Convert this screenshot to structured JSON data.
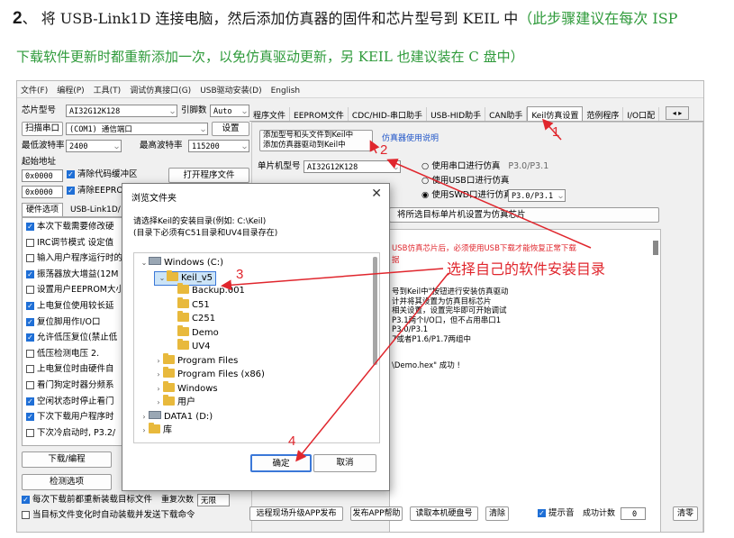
{
  "heading": {
    "number": "2",
    "sep": "、",
    "main": "将 USB-Link1D 连接电脑，然后添加仿真器的固件和芯片型号到 KEIL 中",
    "note_line1": "（此步骤建议在每次 ISP",
    "note_line2": "下载软件更新时都重新添加一次，以免仿真驱动更新，另 KEIL 也建议装在 C 盘中）"
  },
  "menu": [
    "文件(F)",
    "编程(P)",
    "工具(T)",
    "调试仿真接口(G)",
    "USB驱动安装(D)",
    "English"
  ],
  "left_panel": {
    "chip_label": "芯片型号",
    "chip_value": "AI32G12K128",
    "pin_label": "引脚数",
    "pin_value": "Auto",
    "scan_button": "扫描串口",
    "port_value": "(COM1) 通信端口",
    "settings_button": "设置",
    "min_baud_label": "最低波特率",
    "min_baud_value": "2400",
    "max_baud_label": "最高波特率",
    "max_baud_value": "115200",
    "start_addr_label": "起始地址",
    "addr1": "0x0000",
    "clear_code_label": "清除代码缓冲区",
    "open_file_button": "打开程序文件",
    "addr2": "0x0000",
    "clear_eeprom_label": "清除EEPROM缓",
    "hw_tab": "硬件选项",
    "link_tab": "USB-Link1D/",
    "options": [
      {
        "checked": true,
        "text": "本次下载需要修改硬"
      },
      {
        "checked": false,
        "text": "IRC调节模式   设定值"
      },
      {
        "checked": false,
        "text": "输入用户程序运行时的"
      },
      {
        "checked": true,
        "text": "振荡器放大增益(12M"
      },
      {
        "checked": false,
        "text": "设置用户EEPROM大小"
      },
      {
        "checked": true,
        "text": "上电复位使用较长延"
      },
      {
        "checked": true,
        "text": "复位脚用作I/O口"
      },
      {
        "checked": true,
        "text": "允许低压复位(禁止低"
      },
      {
        "checked": false,
        "text": "低压检测电压   2."
      },
      {
        "checked": false,
        "text": "上电复位时由硬件自"
      },
      {
        "checked": false,
        "text": "看门狗定时器分频系"
      },
      {
        "checked": true,
        "text": "空闲状态时停止看门"
      },
      {
        "checked": true,
        "text": "下次下载用户程序时"
      },
      {
        "checked": false,
        "text": "下次冷启动时, P3.2/"
      }
    ],
    "download_button": "下载/编程",
    "check_button": "检测选项",
    "bottom_check1": "每次下载前都重新装载目标文件",
    "repeat_label": "重复次数",
    "repeat_value": "无限",
    "bottom_check2": "当目标文件变化时自动装载并发送下载命令"
  },
  "right_panel": {
    "tabs": [
      "程序文件",
      "EEPROM文件",
      "CDC/HID-串口助手",
      "USB-HID助手",
      "CAN助手",
      "Keil仿真设置",
      "范例程序",
      "I/O口配"
    ],
    "add_button": "添加型号和头文件到Keil中\n添加仿真器驱动到Keil中",
    "sim_link": "仿真器使用说明",
    "mcu_label": "单片机型号",
    "mcu_value": "AI32G12K128",
    "radio1": "使用串口进行仿真",
    "radio1_value": "P3.0/P3.1",
    "radio2": "使用USB口进行仿真",
    "radio3": "使用SWD口进行仿真",
    "radio3_value": "P3.0/P3.1",
    "target_note": "将所选目标单片机设置为仿真芯片",
    "red_line1": "USB仿真芯片后，必须使用USB下载才能恢复正常下载",
    "red_line2": "据",
    "info_lines": [
      "号到Keil中\"按钮进行安装仿真驱动",
      "计并将其设置为仿真目标芯片",
      "相关设置，设置完毕即可开始调试",
      "P3.1两个I/O口，但不占用串口1",
      "P3.0/P3.1",
      "7或者P1.6/P1.7两组中"
    ],
    "log_line": "\\Demo.hex\" 成功 !",
    "bottom_buttons": [
      "远程现场升级APP发布",
      "发布APP帮助",
      "读取本机硬盘号",
      "清除"
    ],
    "prompt_label": "提示音",
    "count_label": "成功计数",
    "count_value": "0",
    "clear_button": "清零"
  },
  "dialog": {
    "title": "浏览文件夹",
    "desc1": "请选择Keil的安装目录(例如: C:\\Keil)",
    "desc2": "(目录下必须有C51目录和UV4目录存在)",
    "tree": [
      {
        "label": "Windows (C:)",
        "type": "drive",
        "level": 0,
        "expanded": true
      },
      {
        "label": "Keil_v5",
        "type": "folder",
        "level": 1,
        "expanded": true,
        "selected": true
      },
      {
        "label": "Backup.001",
        "type": "folder",
        "level": 2
      },
      {
        "label": "C51",
        "type": "folder",
        "level": 2
      },
      {
        "label": "C251",
        "type": "folder",
        "level": 2
      },
      {
        "label": "Demo",
        "type": "folder",
        "level": 2
      },
      {
        "label": "UV4",
        "type": "folder",
        "level": 2
      },
      {
        "label": "Program Files",
        "type": "folder",
        "level": 1
      },
      {
        "label": "Program Files (x86)",
        "type": "folder",
        "level": 1
      },
      {
        "label": "Windows",
        "type": "folder",
        "level": 1
      },
      {
        "label": "用户",
        "type": "folder",
        "level": 1
      },
      {
        "label": "DATA1 (D:)",
        "type": "drive",
        "level": 0
      },
      {
        "label": "库",
        "type": "folder",
        "level": 0
      }
    ],
    "ok_button": "确定",
    "cancel_button": "取消"
  },
  "annotations": {
    "n1": "1",
    "n2": "2",
    "n3": "3",
    "n4": "4",
    "callout": "选择自己的软件安装目录",
    "color": "#e0262d"
  }
}
